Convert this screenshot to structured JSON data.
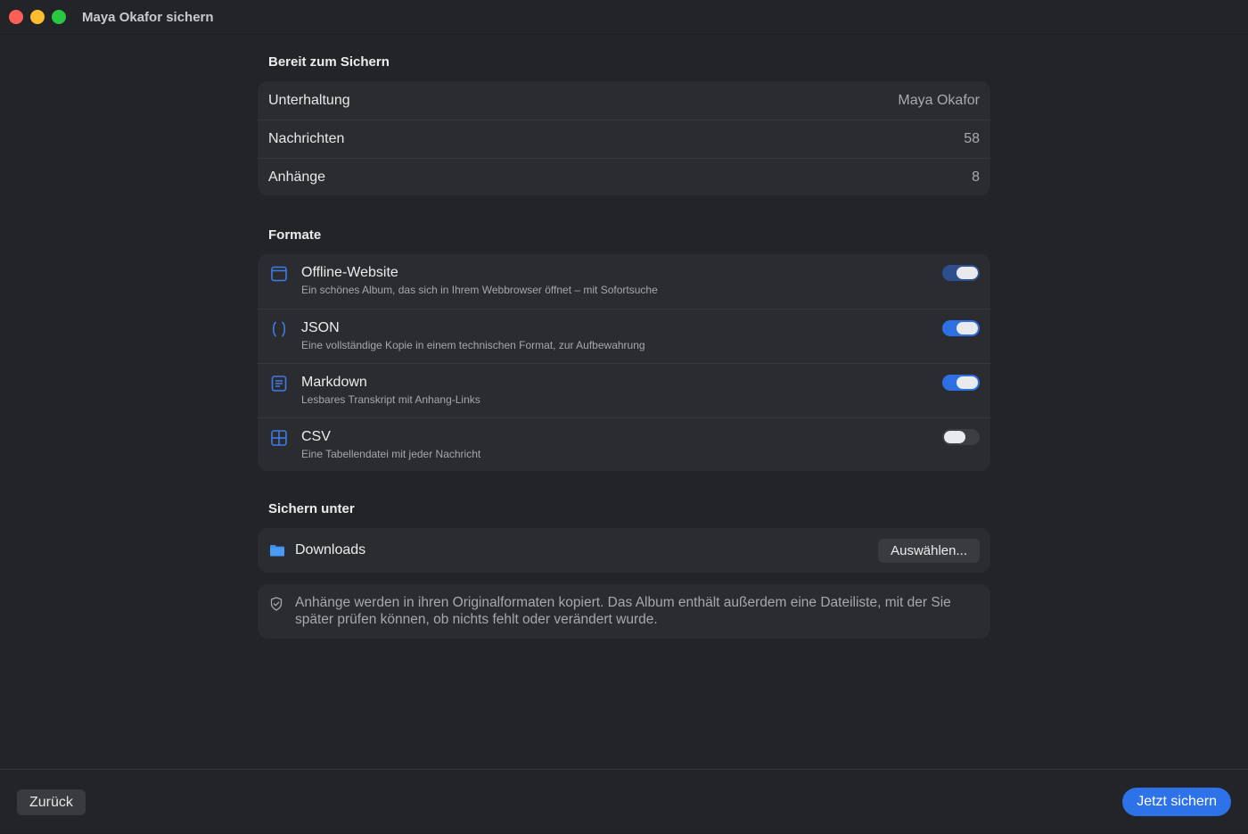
{
  "window": {
    "title": "Maya Okafor sichern"
  },
  "summary": {
    "heading": "Bereit zum Sichern",
    "rows": [
      {
        "label": "Unterhaltung",
        "value": "Maya Okafor"
      },
      {
        "label": "Nachrichten",
        "value": "58"
      },
      {
        "label": "Anhänge",
        "value": "8"
      }
    ]
  },
  "formats": {
    "heading": "Formate",
    "items": [
      {
        "icon": "browser-window-icon",
        "name": "Offline-Website",
        "description": "Ein schönes Album, das sich in Ihrem Webbrowser öffnet – mit Sofortsuche",
        "enabled": true
      },
      {
        "icon": "braces-icon",
        "name": "JSON",
        "description": "Eine vollständige Kopie in einem technischen Format, zur Aufbewahrung",
        "enabled": true
      },
      {
        "icon": "document-lines-icon",
        "name": "Markdown",
        "description": "Lesbares Transkript mit Anhang-Links",
        "enabled": true
      },
      {
        "icon": "table-grid-icon",
        "name": "CSV",
        "description": "Eine Tabellendatei mit jeder Nachricht",
        "enabled": false
      }
    ]
  },
  "destination": {
    "heading": "Sichern unter",
    "folder_name": "Downloads",
    "choose_label": "Auswählen..."
  },
  "info": {
    "text": "Anhänge werden in ihren Originalformaten kopiert. Das Album enthält außerdem eine Dateiliste, mit der Sie später prüfen können, ob nichts fehlt oder verändert wurde."
  },
  "footer": {
    "back_label": "Zurück",
    "primary_label": "Jetzt sichern"
  },
  "colors": {
    "accent": "#2d72e8",
    "icon_blue": "#3f7be6",
    "background": "#232428",
    "card": "#2b2c30"
  }
}
